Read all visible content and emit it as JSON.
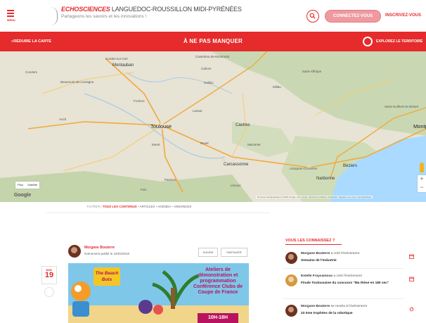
{
  "header": {
    "menu_label": "MENU",
    "brand_strong": "ECHOSCIENCES",
    "brand_rest": " LANGUEDOC-ROUSSILLON MIDI-PYRÉNÉES",
    "tagline": "Partageons les savoirs et les innovations !",
    "connect_label": "CONNECTEZ-VOUS",
    "signup_label": "INSCRIVEZ-VOUS"
  },
  "banner": {
    "reduce_label": "RÉDUIRE LA CARTE",
    "title": "À NE PAS MANQUER",
    "explore_label": "EXPLOREZ LE TERRITOIRE"
  },
  "map": {
    "labels": [
      "Cordes-sur-Ciel",
      "Montauban",
      "Castelnau-de-Montmiral",
      "Cahors",
      "Saint-Affrique",
      "Condom",
      "Beaumont-de-Lomagne",
      "Gaillac",
      "Millau",
      "Fronton",
      "Lavaur",
      "Saint-Guilhem-le-Désert",
      "Toulouse",
      "Castres",
      "Béziers",
      "Auch",
      "Muret",
      "Revel",
      "Mazamet",
      "Carcassonne",
      "Narbonne",
      "Pamiers",
      "Foix",
      "Limoux",
      "Lézignan-Corbières",
      "Montp"
    ],
    "type_plan": "Plan",
    "type_sat": "Satellite",
    "google": "Google",
    "attribution": "Données cartographiques ©2016 Google, Inst. Geogr. Nacional   Conditions d'utilisation   Signaler une erreur cartographique",
    "zoom_in": "+",
    "zoom_out": "−"
  },
  "filter": {
    "prefix": "FILTRER",
    "active": "TOUS LES CONTENUS",
    "options": [
      "ARTICLES",
      "AGENDA",
      "ANNONCES"
    ]
  },
  "event": {
    "author": "Morgane Bouterre",
    "subtitle": "événement publié le 16/02/2016",
    "btn_left": "SUIVRE",
    "btn_right": "PARTAGER",
    "date_month": "MAR.",
    "date_day": "19",
    "poster_badge": "The Beach Bots",
    "poster_title": "Ateliers de démonstration et programmation Conférence Clubs de Coupe de France",
    "poster_time": "10H-18H"
  },
  "sidebar": {
    "title": "VOUS LES CONNAISSEZ ?",
    "items": [
      {
        "name": "Morgane Bouterre",
        "action": "a créé l'événement",
        "target": "Semaine de l'Industrie",
        "icon": "calendar-icon"
      },
      {
        "name": "Estelle Fraysainous",
        "action": "a créé l'événement",
        "target": "Finale Toulousaine du concours \"Ma thèse en 180 sec\"",
        "icon": "calendar-icon"
      },
      {
        "name": "Morgane Bouterre",
        "action": "se rendra à l'événement",
        "target": "23 ème trophées de la robotique",
        "icon": "share-icon"
      }
    ]
  },
  "colors": {
    "accent": "#e52b2b",
    "connect_bg": "#ee9aa0",
    "poster_magenta": "#b8135f"
  }
}
